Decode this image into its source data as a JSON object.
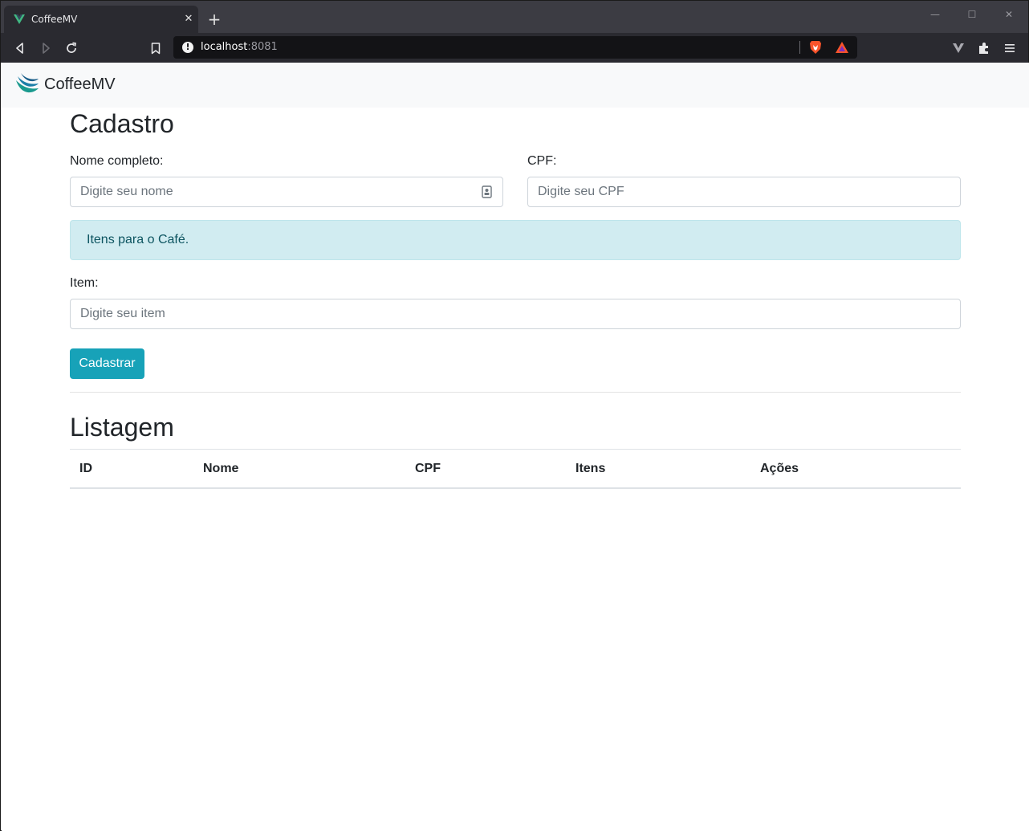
{
  "browser": {
    "tab_title": "CoffeeMV",
    "tab_close": "✕",
    "new_tab": "+",
    "url_host": "localhost",
    "url_port": ":8081",
    "window_controls": {
      "minimize": "—",
      "maximize": "☐",
      "close": "✕"
    }
  },
  "navbar": {
    "brand": "CoffeeMV"
  },
  "cadastro": {
    "title": "Cadastro",
    "nome_label": "Nome completo:",
    "nome_placeholder": "Digite seu nome",
    "cpf_label": "CPF:",
    "cpf_placeholder": "Digite seu CPF",
    "alert_text": "Itens para o Café.",
    "item_label": "Item:",
    "item_placeholder": "Digite seu item",
    "submit_label": "Cadastrar"
  },
  "listagem": {
    "title": "Listagem",
    "columns": [
      "ID",
      "Nome",
      "CPF",
      "Itens",
      "Ações"
    ]
  },
  "colors": {
    "primary_button": "#17a2b8",
    "alert_bg": "#d1ecf1",
    "alert_text": "#0c5460",
    "navbar_bg": "#f8f9fa"
  }
}
